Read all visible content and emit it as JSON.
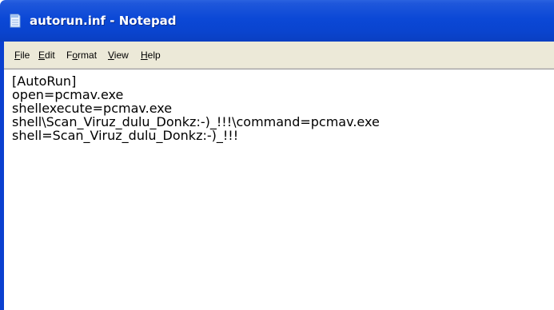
{
  "window": {
    "title": "autorun.inf - Notepad",
    "icon": "notepad-icon"
  },
  "menu": {
    "file": {
      "accel": "F",
      "rest": "ile"
    },
    "edit": {
      "accel": "E",
      "rest": "dit"
    },
    "format": {
      "pre": "F",
      "accel": "o",
      "rest": "rmat"
    },
    "view": {
      "accel": "V",
      "rest": "iew"
    },
    "help": {
      "accel": "H",
      "rest": "elp"
    }
  },
  "document": {
    "lines": [
      "[AutoRun]",
      "open=pcmav.exe",
      "shellexecute=pcmav.exe",
      "shell\\Scan_Viruz_dulu_Donkz:-)_!!!\\command=pcmav.exe",
      "shell=Scan_Viruz_dulu_Donkz:-)_!!!"
    ]
  },
  "colors": {
    "titlebar": "#0b48d6",
    "menubar": "#ece9d8",
    "editor_bg": "#ffffff",
    "text": "#000000"
  }
}
